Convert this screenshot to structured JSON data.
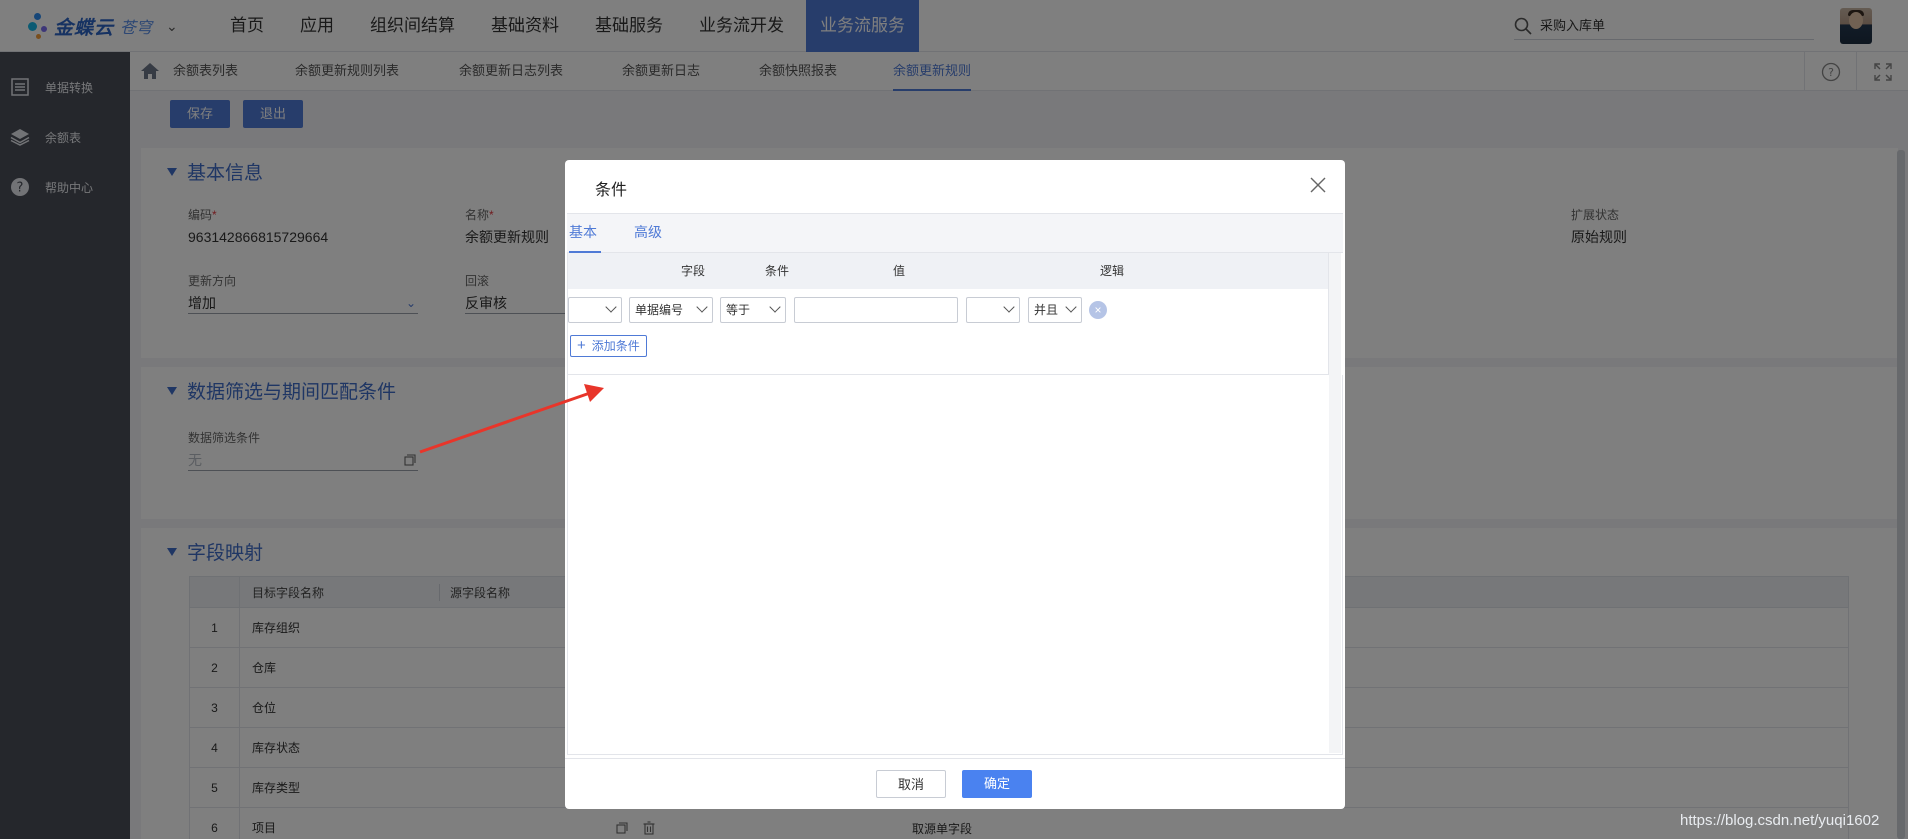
{
  "app": {
    "logo_text": "金蝶云",
    "logo_sub": "苍穹",
    "search_placeholder": "采购入库单"
  },
  "topnav": [
    {
      "label": "首页"
    },
    {
      "label": "应用"
    },
    {
      "label": "组织间结算"
    },
    {
      "label": "基础资料"
    },
    {
      "label": "基础服务"
    },
    {
      "label": "业务流开发"
    },
    {
      "label": "业务流服务",
      "active": true
    }
  ],
  "sidebar": [
    {
      "label": "单据转换",
      "icon": "list-icon"
    },
    {
      "label": "余额表",
      "icon": "layers-icon"
    },
    {
      "label": "帮助中心",
      "icon": "help-circle-icon"
    }
  ],
  "tabs": [
    {
      "label": "余额表列表"
    },
    {
      "label": "余额更新规则列表"
    },
    {
      "label": "余额更新日志列表"
    },
    {
      "label": "余额更新日志"
    },
    {
      "label": "余额快照报表"
    },
    {
      "label": "余额更新规则",
      "active": true
    }
  ],
  "toolbar": {
    "save": "保存",
    "exit": "退出"
  },
  "basic": {
    "title": "基本信息",
    "code_label": "编码",
    "code_value": "963142866815729664",
    "name_label": "名称",
    "name_value": "余额更新规则",
    "ext_label": "扩展状态",
    "ext_value": "原始规则",
    "dir_label": "更新方向",
    "dir_value": "增加",
    "rollback_label": "回滚",
    "rollback_value": "反审核"
  },
  "filter": {
    "title": "数据筛选与期间匹配条件",
    "cond_label": "数据筛选条件",
    "cond_value": "无"
  },
  "mapping": {
    "title": "字段映射",
    "col_target": "目标字段名称",
    "col_source": "源字段名称",
    "rows": [
      {
        "idx": "1",
        "name": "库存组织"
      },
      {
        "idx": "2",
        "name": "仓库"
      },
      {
        "idx": "3",
        "name": "仓位"
      },
      {
        "idx": "4",
        "name": "库存状态"
      },
      {
        "idx": "5",
        "name": "库存类型"
      },
      {
        "idx": "6",
        "name": "项目",
        "extra": "取源单字段"
      }
    ]
  },
  "dialog": {
    "title": "条件",
    "tab_basic": "基本",
    "tab_advanced": "高级",
    "col_field": "字段",
    "col_condition": "条件",
    "col_value": "值",
    "col_logic": "逻辑",
    "row": {
      "left_paren": "",
      "field": "单据编号",
      "condition": "等于",
      "value": "",
      "right_paren": "",
      "logic": "并且"
    },
    "add_condition": "添加条件",
    "cancel": "取消",
    "ok": "确定"
  },
  "watermark": "https://blog.csdn.net/yuqi1602",
  "colors": {
    "accent": "#4f7ad6",
    "sidebar": "#4a4e59",
    "arrow": "#e8352a"
  }
}
